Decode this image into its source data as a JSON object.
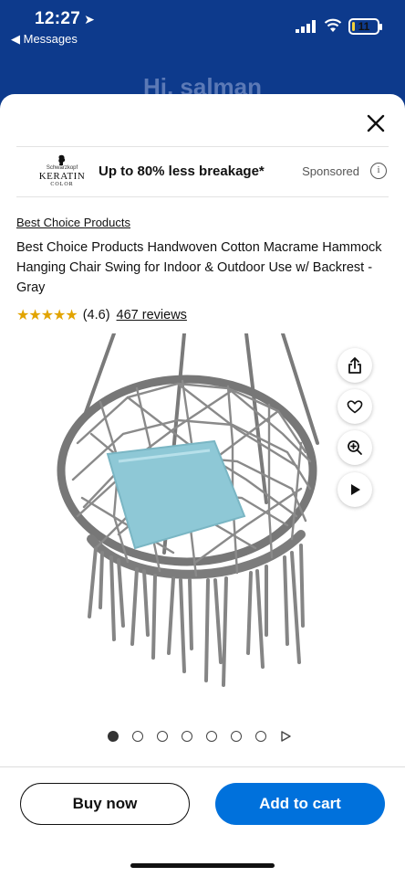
{
  "status": {
    "time": "12:27",
    "back_label": "◀ Messages",
    "battery": "11",
    "battery_level": 0.11
  },
  "background": {
    "greeting": "Hi, salman"
  },
  "ad": {
    "logo_small": "Schwarzkopf",
    "logo_main": "KERATIN",
    "logo_sub": "COLOR",
    "text": "Up to 80% less breakage*",
    "sponsored": "Sponsored",
    "info_glyph": "i"
  },
  "product": {
    "brand": "Best Choice Products",
    "title": "Best Choice Products Handwoven Cotton Macrame Hammock Hanging Chair Swing for Indoor & Outdoor Use w/ Backrest - Gray",
    "stars_display": "★★★★★",
    "rating_value": 4.6,
    "rating_text": "(4.6)",
    "reviews": "467 reviews"
  },
  "carousel": {
    "count": 7,
    "active_index": 0
  },
  "icons": {
    "close": "close-icon",
    "share": "share-icon",
    "heart": "heart-icon",
    "zoom": "zoom-in-icon",
    "play": "play-icon"
  },
  "actions": {
    "buy_now": "Buy now",
    "add_to_cart": "Add to cart"
  },
  "colors": {
    "accent": "#0071dc",
    "header_bg": "#0d3a8c",
    "star": "#e2a400",
    "pillow": "#8ec8d6"
  }
}
